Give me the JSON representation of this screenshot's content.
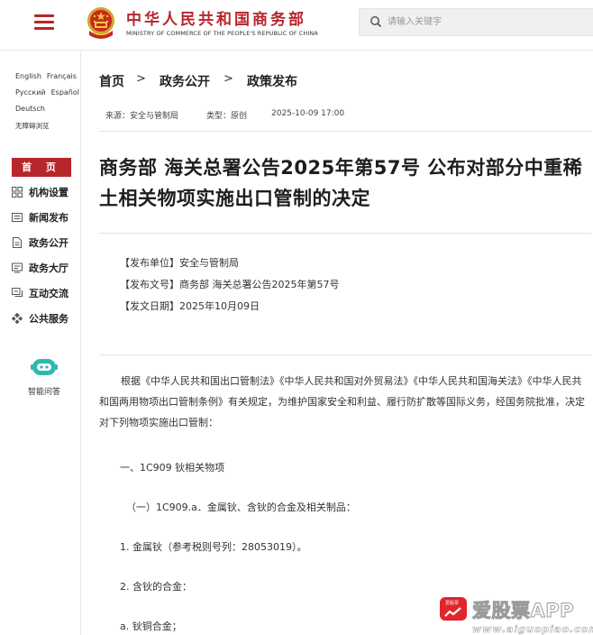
{
  "header": {
    "site_title": "中华人民共和国商务部",
    "site_subtitle": "MINISTRY OF COMMERCE OF THE PEOPLE'S REPUBLIC OF CHINA",
    "search_placeholder": "请输入关键字",
    "brand_color": "#b6262b"
  },
  "sidebar": {
    "languages": {
      "english": "English",
      "french": "Français",
      "russian": "Русский",
      "spanish": "Español",
      "german": "Deutsch",
      "accessible": "无障碍浏览"
    },
    "home_label": "首 页",
    "nav": [
      {
        "label": "机构设置",
        "icon": "org-grid-icon"
      },
      {
        "label": "新闻发布",
        "icon": "news-icon"
      },
      {
        "label": "政务公开",
        "icon": "document-icon"
      },
      {
        "label": "政务大厅",
        "icon": "service-hall-icon"
      },
      {
        "label": "互动交流",
        "icon": "chat-icon"
      },
      {
        "label": "公共服务",
        "icon": "public-service-icon"
      }
    ],
    "assistant_label": "智能问答"
  },
  "breadcrumb": [
    "首页",
    "政务公开",
    "政策发布"
  ],
  "meta": {
    "source": "来源：安全与管制局",
    "type": "类型：原创",
    "date": "2025-10-09 17:00"
  },
  "article": {
    "title": "商务部 海关总署公告2025年第57号 公布对部分中重稀土相关物项实施出口管制的决定",
    "info": {
      "issuer": "【发布单位】安全与管制局",
      "doc_no": "【发布文号】商务部 海关总署公告2025年第57号",
      "date": "【发文日期】2025年10月09日"
    },
    "intro": "根据《中华人民共和国出口管制法》《中华人民共和国对外贸易法》《中华人民共和国海关法》《中华人民共和国两用物项出口管制条例》有关规定，为维护国家安全和利益、履行防扩散等国际义务，经国务院批准，决定对下列物项实施出口管制：",
    "section1": "一、1C909 钬相关物项",
    "subsection1": "（一）1C909.a．金属钬、含钬的合金及相关制品：",
    "item1": "1. 金属钬（参考税则号列：28053019）。",
    "item2": "2. 含钬的合金：",
    "item2a": "a. 钬铜合金；"
  },
  "watermark": {
    "logo_text": "爱股票",
    "text": "爱股票APP",
    "url": "www.aiguopiao.com"
  }
}
